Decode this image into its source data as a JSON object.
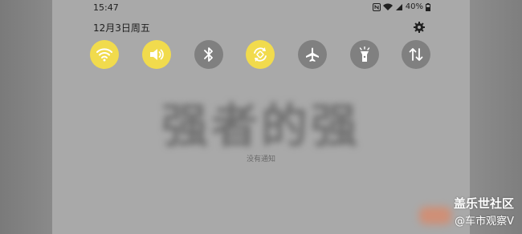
{
  "status_bar": {
    "time": "15:47",
    "battery": "40%"
  },
  "header": {
    "date": "12月3日周五"
  },
  "background_title": "强者的强",
  "notifications": {
    "empty_text": "没有通知"
  },
  "watermark": {
    "line1": "盖乐世社区",
    "line2": "@车市观察V"
  },
  "colors": {
    "tile_on": "#f1db4d",
    "tile_off": "#808080",
    "panel_bg": "#a9a9a9"
  },
  "tiles": [
    {
      "name": "wifi",
      "icon": "wifi-icon",
      "state": "on"
    },
    {
      "name": "sound",
      "icon": "volume-icon",
      "state": "on"
    },
    {
      "name": "bluetooth",
      "icon": "bluetooth-icon",
      "state": "off"
    },
    {
      "name": "auto-rotate",
      "icon": "rotate-icon",
      "state": "on"
    },
    {
      "name": "airplane",
      "icon": "airplane-icon",
      "state": "off"
    },
    {
      "name": "flashlight",
      "icon": "flashlight-icon",
      "state": "off"
    },
    {
      "name": "mobile-data",
      "icon": "data-arrows-icon",
      "state": "off"
    }
  ]
}
